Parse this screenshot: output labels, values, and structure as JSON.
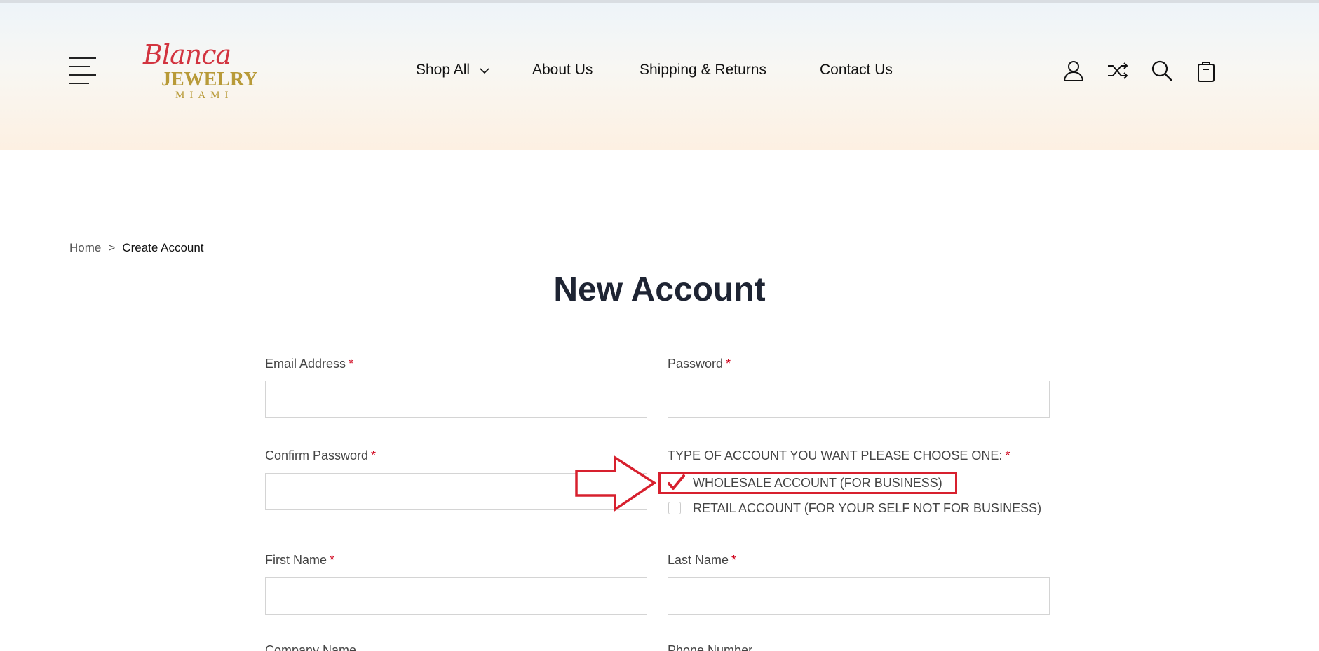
{
  "header": {
    "logo": {
      "script": "Blanca",
      "brand": "JEWELRY",
      "sub": "MIAMI"
    },
    "nav": [
      {
        "label": "Shop All"
      },
      {
        "label": "About Us"
      },
      {
        "label": "Shipping & Returns"
      },
      {
        "label": "Contact Us"
      }
    ],
    "icons": [
      "account-icon",
      "shuffle-icon",
      "search-icon",
      "shopping-bag-icon"
    ]
  },
  "breadcrumb": {
    "home": "Home",
    "separator": ">",
    "current": "Create Account"
  },
  "page_title": "New Account",
  "form": {
    "required_mark": "*",
    "email": {
      "label": "Email Address",
      "value": ""
    },
    "password": {
      "label": "Password",
      "value": ""
    },
    "confirm_password": {
      "label": "Confirm Password",
      "value": ""
    },
    "account_type": {
      "label": "TYPE OF ACCOUNT YOU WANT PLEASE CHOOSE ONE:",
      "options": [
        {
          "label": "WHOLESALE ACCOUNT (FOR BUSINESS)",
          "checked": true
        },
        {
          "label": "RETAIL ACCOUNT (FOR YOUR SELF NOT FOR BUSINESS)",
          "checked": false
        }
      ]
    },
    "first_name": {
      "label": "First Name",
      "value": ""
    },
    "last_name": {
      "label": "Last Name",
      "value": ""
    },
    "company_name": {
      "label": "Company Name"
    },
    "phone_number": {
      "label": "Phone Number"
    }
  },
  "colors": {
    "accent_red": "#d7202e",
    "title": "#1e2433",
    "gold": "#b89a38"
  }
}
